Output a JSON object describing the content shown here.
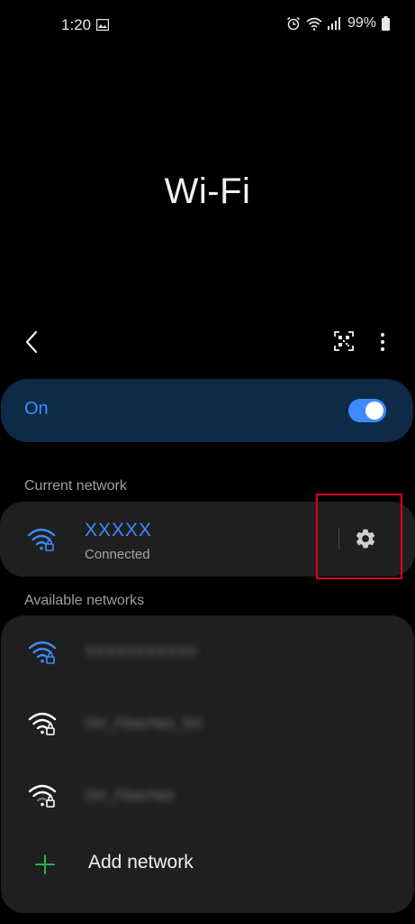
{
  "status_bar": {
    "time": "1:20",
    "battery": "99%",
    "icons": [
      "gallery-icon",
      "alarm-icon",
      "wifi-status-icon",
      "signal-icon",
      "battery-icon"
    ]
  },
  "page": {
    "title": "Wi-Fi"
  },
  "toolbar": {
    "icons": [
      "back-icon",
      "qr-scan-icon",
      "more-options-icon"
    ]
  },
  "wifi_toggle": {
    "label": "On",
    "enabled": true
  },
  "current_network": {
    "section_label": "Current network",
    "name": "XXXXX",
    "status": "Connected"
  },
  "available_networks": {
    "section_label": "Available networks",
    "items": [
      {
        "name": "XXXXXXXXXXX"
      },
      {
        "name": "DH_FiberNet_5G"
      },
      {
        "name": "DH_FiberNet"
      }
    ],
    "add_label": "Add network"
  },
  "colors": {
    "accent": "#3d8bff",
    "card": "#1f1f1f",
    "highlight": "#e3001a",
    "add": "#2bb34a"
  }
}
